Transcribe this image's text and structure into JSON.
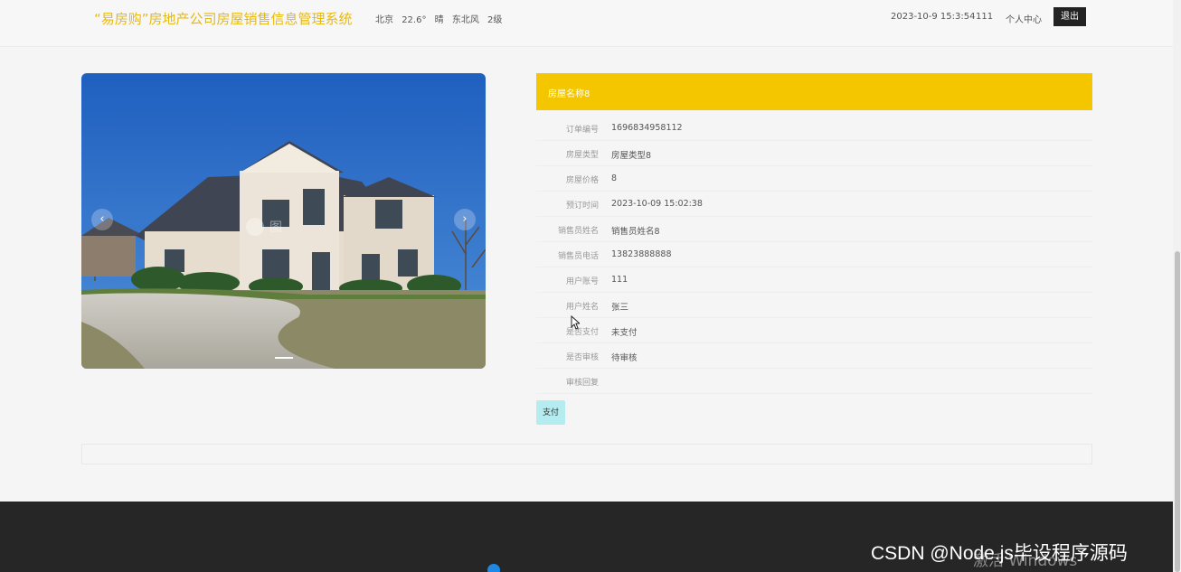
{
  "header": {
    "title": "“易房购”房地产公司房屋销售信息管理系统",
    "weather": {
      "city": "北京",
      "temperature": "22.6°",
      "condition": "晴",
      "wind": "东北风",
      "level": "2级"
    },
    "datetime": "2023-10-9 15:3:54",
    "username": "111",
    "profile_label": "个人中心",
    "logout_label": "退出"
  },
  "carousel": {
    "prev_label": "‹",
    "next_label": "›",
    "watermark_text": "图"
  },
  "detail": {
    "title": "房屋名称8",
    "fields": [
      {
        "label": "订单编号",
        "value": "1696834958112"
      },
      {
        "label": "房屋类型",
        "value": "房屋类型8"
      },
      {
        "label": "房屋价格",
        "value": "8"
      },
      {
        "label": "预订时间",
        "value": "2023-10-09 15:02:38"
      },
      {
        "label": "销售员姓名",
        "value": "销售员姓名8"
      },
      {
        "label": "销售员电话",
        "value": "13823888888"
      },
      {
        "label": "用户账号",
        "value": "111"
      },
      {
        "label": "用户姓名",
        "value": "张三"
      },
      {
        "label": "是否支付",
        "value": "未支付"
      },
      {
        "label": "是否审核",
        "value": "待审核"
      },
      {
        "label": "审核回复",
        "value": ""
      }
    ],
    "pay_label": "支付"
  },
  "footer": {
    "activation_text": "激活 Windows",
    "watermark": "CSDN @Node.js毕设程序源码"
  },
  "colors": {
    "accent": "#f3c600",
    "title": "#e8b90f",
    "pay_button": "#b5ecef",
    "footer": "#262626"
  }
}
